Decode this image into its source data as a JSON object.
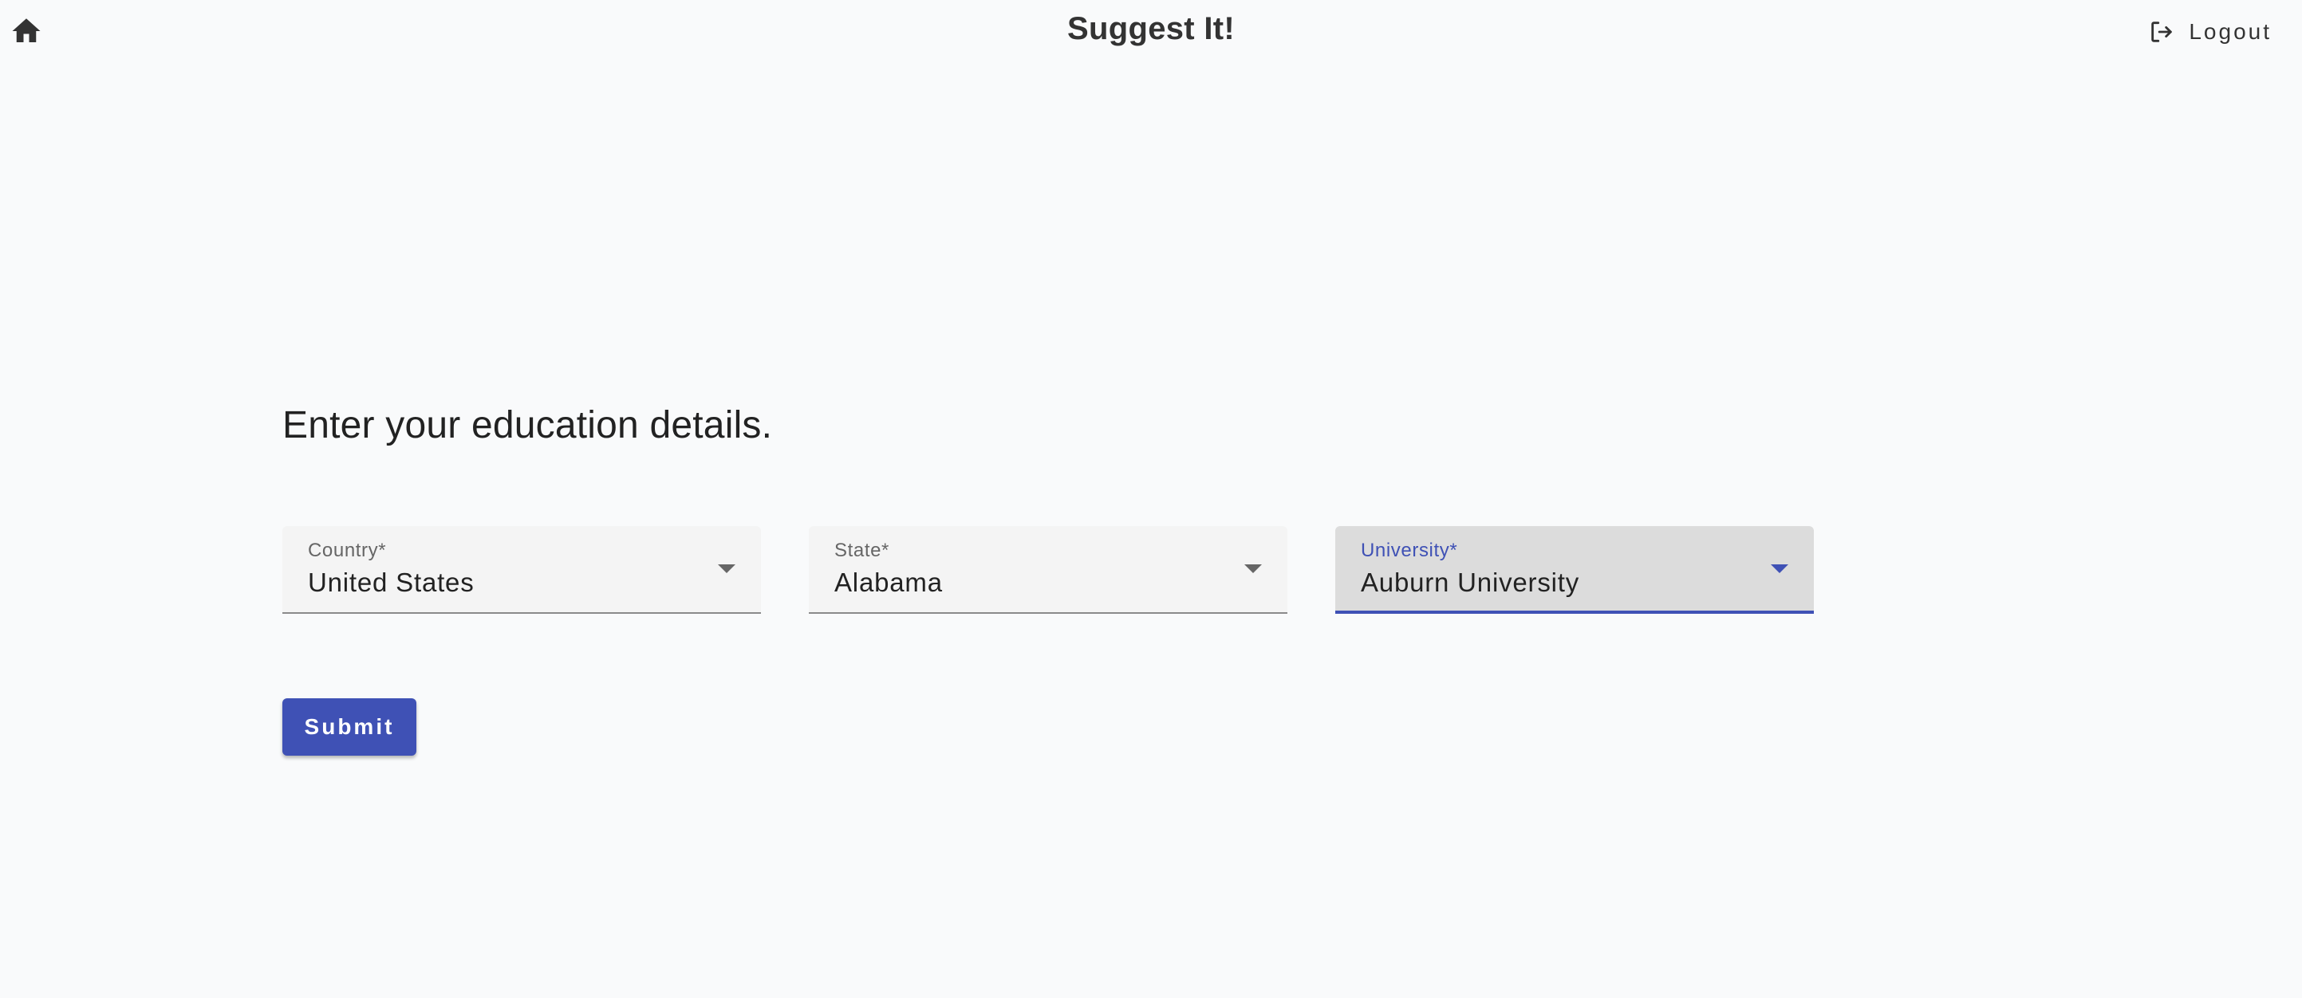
{
  "header": {
    "title": "Suggest It!",
    "home_icon": "home-icon",
    "logout": {
      "label": "Logout",
      "icon": "logout-icon"
    }
  },
  "form": {
    "heading": "Enter your education details.",
    "fields": [
      {
        "label": "Country*",
        "value": "United States",
        "focused": false
      },
      {
        "label": "State*",
        "value": "Alabama",
        "focused": false
      },
      {
        "label": "University*",
        "value": "Auburn University",
        "focused": true
      }
    ],
    "submit_label": "Submit"
  },
  "colors": {
    "accent": "#3f51b5",
    "background": "#f9fafb",
    "field_background": "#f4f4f4",
    "field_focused_background": "#dcdcdc"
  }
}
